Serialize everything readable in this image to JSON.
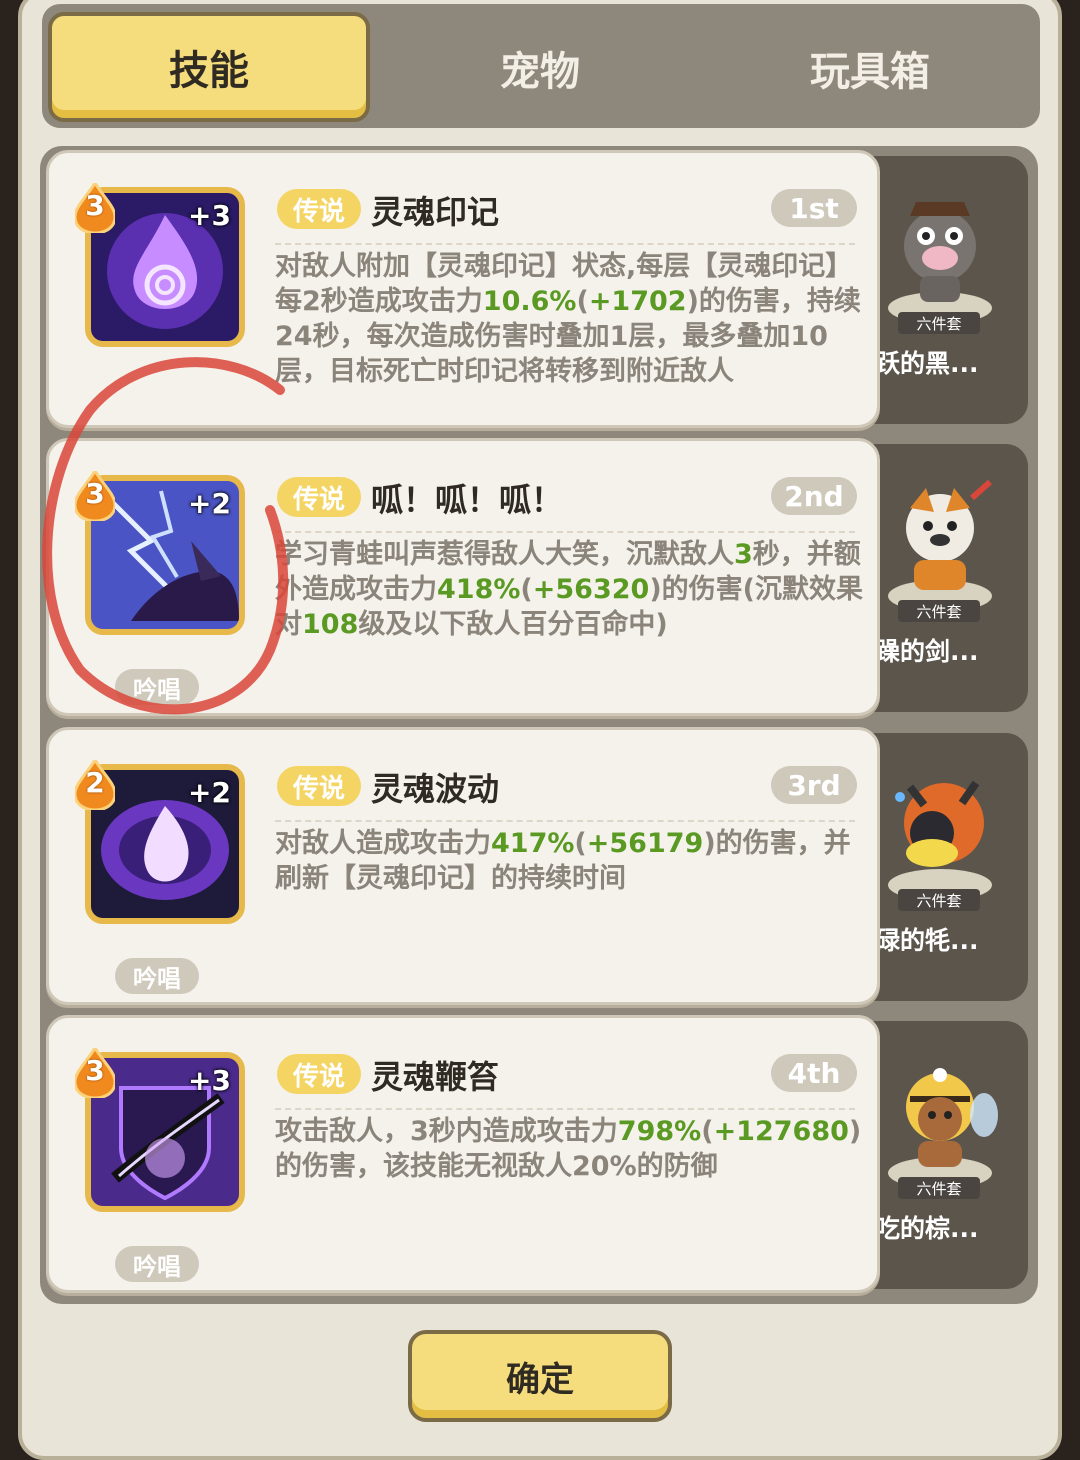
{
  "tabs": [
    {
      "label": "技能",
      "active": true
    },
    {
      "label": "宠物",
      "active": false
    },
    {
      "label": "玩具箱",
      "active": false
    }
  ],
  "colors": {
    "accent_yellow": "#f5dc7c",
    "highlight_green": "#5a9a22",
    "annotation_red": "#d9463a"
  },
  "skills": [
    {
      "level": "3",
      "plus": "+3",
      "badge": "传说",
      "name": "灵魂印记",
      "rank": "1st",
      "chant": "",
      "icon": "purple-flame-icon",
      "desc": [
        {
          "t": "对敌人附加【灵魂印记】状态,每层【灵魂印记】每2秒造成攻击力"
        },
        {
          "t": "10.6%",
          "g": true
        },
        {
          "t": "("
        },
        {
          "t": "+1702",
          "g": true
        },
        {
          "t": ")的伤害，持续24秒，每次造成伤害时叠加1层，最多叠加10层，目标死亡时印记将转移到附近敌人"
        }
      ],
      "pet": {
        "label": "六件套",
        "name": "活跃的黑...",
        "icon": "pig-pet-icon"
      }
    },
    {
      "level": "3",
      "plus": "+2",
      "badge": "传说",
      "name": "呱！呱！呱！",
      "rank": "2nd",
      "chant": "吟唱",
      "icon": "lightning-frog-icon",
      "desc": [
        {
          "t": "学习青蛙叫声惹得敌人大笑，沉默敌人"
        },
        {
          "t": "3",
          "g": true
        },
        {
          "t": "秒，并额外造成攻击力"
        },
        {
          "t": "418%",
          "g": true
        },
        {
          "t": "("
        },
        {
          "t": "+56320",
          "g": true
        },
        {
          "t": ")的伤害(沉默效果对"
        },
        {
          "t": "108",
          "g": true
        },
        {
          "t": "级及以下敌人百分百命中)"
        }
      ],
      "pet": {
        "label": "六件套",
        "name": "暴躁的剑...",
        "icon": "dog-pet-icon"
      }
    },
    {
      "level": "2",
      "plus": "+2",
      "badge": "传说",
      "name": "灵魂波动",
      "rank": "3rd",
      "chant": "吟唱",
      "icon": "soul-wave-icon",
      "desc": [
        {
          "t": "对敌人造成攻击力"
        },
        {
          "t": "417%",
          "g": true
        },
        {
          "t": "("
        },
        {
          "t": "+56179",
          "g": true
        },
        {
          "t": ")的伤害，并刷新【灵魂印记】的持续时间"
        }
      ],
      "pet": {
        "label": "六件套",
        "name": "忙碌的牦...",
        "icon": "yak-pet-icon"
      }
    },
    {
      "level": "3",
      "plus": "+3",
      "badge": "传说",
      "name": "灵魂鞭笞",
      "rank": "4th",
      "chant": "吟唱",
      "icon": "soul-whip-icon",
      "desc": [
        {
          "t": "攻击敌人，3秒内造成攻击力"
        },
        {
          "t": "798%",
          "g": true
        },
        {
          "t": "("
        },
        {
          "t": "+127680",
          "g": true
        },
        {
          "t": ")的伤害，该技能无视敌人20%的防御"
        }
      ],
      "pet": {
        "label": "六件套",
        "name": "贪吃的棕...",
        "icon": "bee-bear-pet-icon"
      }
    }
  ],
  "confirm_label": "确定"
}
